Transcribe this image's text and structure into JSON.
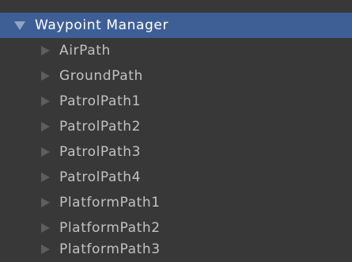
{
  "hierarchy": {
    "root": {
      "label": "Waypoint Manager",
      "expanded": true
    },
    "children": [
      {
        "label": "AirPath"
      },
      {
        "label": "GroundPath"
      },
      {
        "label": "PatrolPath1"
      },
      {
        "label": "PatrolPath2"
      },
      {
        "label": "PatrolPath3"
      },
      {
        "label": "PatrolPath4"
      },
      {
        "label": "PlatformPath1"
      },
      {
        "label": "PlatformPath2"
      },
      {
        "label": "PlatformPath3"
      }
    ]
  },
  "icons": {
    "root_arrow": "triangle-down-icon",
    "child_arrow": "triangle-right-icon"
  },
  "colors": {
    "background": "#383838",
    "selection": "#3e5f96",
    "text": "#c2c2c2",
    "selected_text": "#ffffff",
    "foldout_arrow": "#5e5e5e"
  }
}
